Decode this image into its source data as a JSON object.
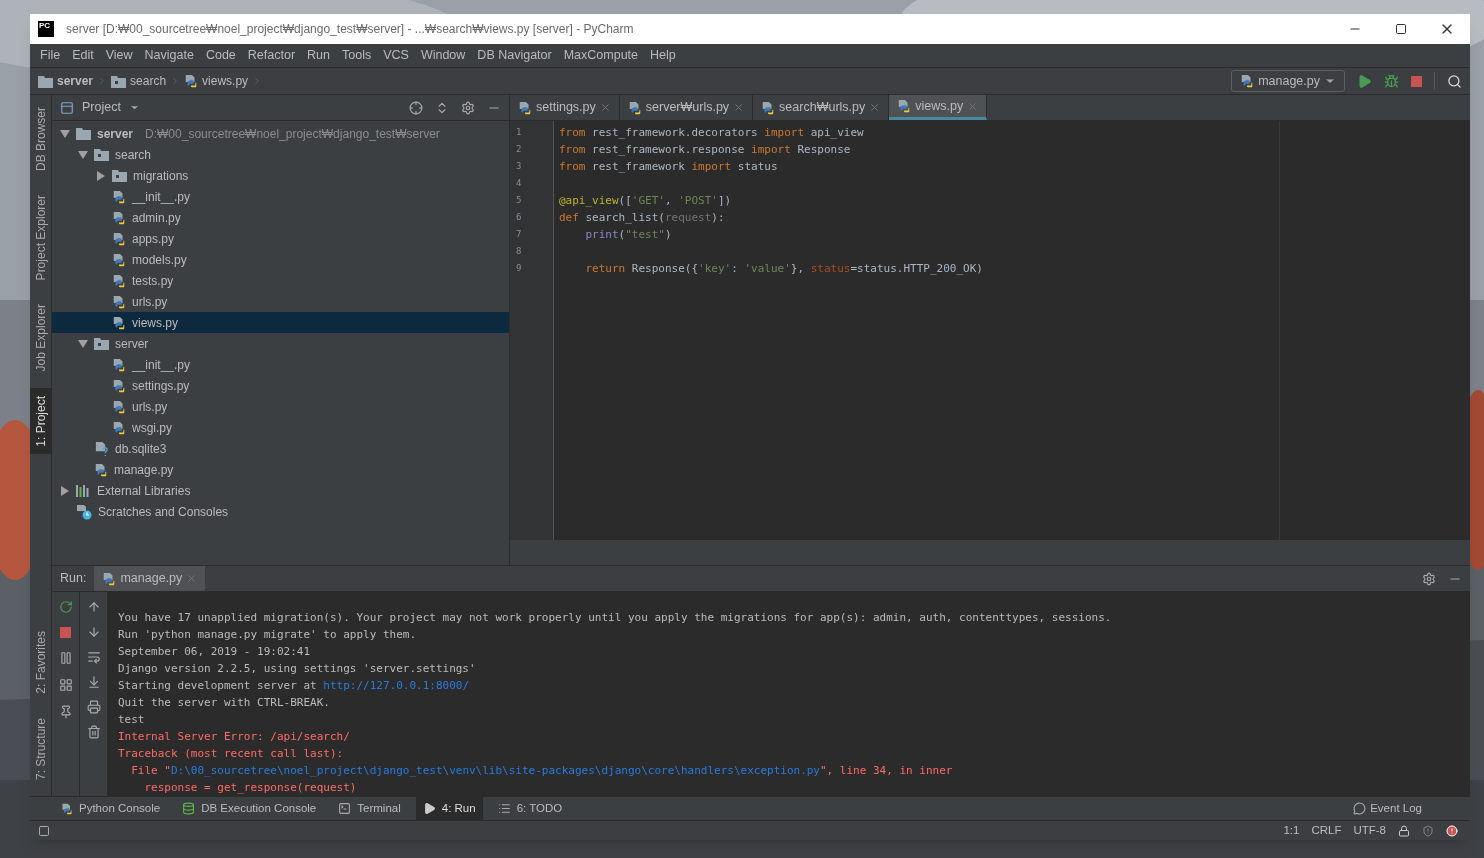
{
  "window": {
    "title": "server [D:₩00_sourcetree₩noel_project₩django_test₩server] - ...₩search₩views.py [server] - PyCharm",
    "app_icon": "PC"
  },
  "menu": [
    "File",
    "Edit",
    "View",
    "Navigate",
    "Code",
    "Refactor",
    "Run",
    "Tools",
    "VCS",
    "Window",
    "DB Navigator",
    "MaxCompute",
    "Help"
  ],
  "breadcrumb": [
    {
      "label": "server",
      "kind": "root"
    },
    {
      "label": "search",
      "kind": "folder"
    },
    {
      "label": "views.py",
      "kind": "file"
    }
  ],
  "run_config": "manage.py",
  "left_tools_top": [
    {
      "label": "DB Browser",
      "selected": false
    },
    {
      "label": "Project Explorer",
      "selected": false
    },
    {
      "label": "Job Explorer",
      "selected": false
    },
    {
      "label": "1: Project",
      "selected": true
    }
  ],
  "left_tools_bottom": [
    {
      "label": "2: Favorites",
      "selected": false
    },
    {
      "label": "7: Structure",
      "selected": false
    }
  ],
  "project_panel": {
    "title": "Project",
    "tree": [
      {
        "label": "server",
        "path": "D:₩00_sourcetree₩noel_project₩django_test₩server",
        "kind": "root",
        "expanded": true,
        "selected": false,
        "children": [
          {
            "label": "search",
            "kind": "folder",
            "expanded": true,
            "selected": false,
            "children": [
              {
                "label": "migrations",
                "kind": "folder",
                "expanded": false,
                "selected": false
              },
              {
                "label": "__init__.py",
                "kind": "py",
                "selected": false
              },
              {
                "label": "admin.py",
                "kind": "py",
                "selected": false
              },
              {
                "label": "apps.py",
                "kind": "py",
                "selected": false
              },
              {
                "label": "models.py",
                "kind": "py",
                "selected": false
              },
              {
                "label": "tests.py",
                "kind": "py",
                "selected": false
              },
              {
                "label": "urls.py",
                "kind": "py",
                "selected": false
              },
              {
                "label": "views.py",
                "kind": "py",
                "selected": true
              }
            ]
          },
          {
            "label": "server",
            "kind": "folder",
            "expanded": true,
            "selected": false,
            "children": [
              {
                "label": "__init__.py",
                "kind": "py",
                "selected": false
              },
              {
                "label": "settings.py",
                "kind": "py",
                "selected": false
              },
              {
                "label": "urls.py",
                "kind": "py",
                "selected": false
              },
              {
                "label": "wsgi.py",
                "kind": "py",
                "selected": false
              }
            ]
          },
          {
            "label": "db.sqlite3",
            "kind": "unknown",
            "selected": false
          },
          {
            "label": "manage.py",
            "kind": "py",
            "selected": false
          }
        ]
      },
      {
        "label": "External Libraries",
        "kind": "libs",
        "expanded": false,
        "selected": false
      },
      {
        "label": "Scratches and Consoles",
        "kind": "scratches",
        "selected": false
      }
    ]
  },
  "editor_tabs": [
    {
      "label": "settings.py",
      "selected": false
    },
    {
      "label": "server₩urls.py",
      "selected": false
    },
    {
      "label": "search₩urls.py",
      "selected": false
    },
    {
      "label": "views.py",
      "selected": true
    }
  ],
  "code": [
    {
      "number": "1",
      "tokens": [
        {
          "kind": "kw",
          "text": "from"
        },
        {
          "kind": "plain",
          "text": " rest_framework.decorators "
        },
        {
          "kind": "kw",
          "text": "import"
        },
        {
          "kind": "plain",
          "text": " api_view"
        }
      ]
    },
    {
      "number": "2",
      "tokens": [
        {
          "kind": "kw",
          "text": "from"
        },
        {
          "kind": "plain",
          "text": " rest_framework.response "
        },
        {
          "kind": "kw",
          "text": "import"
        },
        {
          "kind": "plain",
          "text": " Response"
        }
      ]
    },
    {
      "number": "3",
      "tokens": [
        {
          "kind": "kw",
          "text": "from"
        },
        {
          "kind": "plain",
          "text": " rest_framework "
        },
        {
          "kind": "kw",
          "text": "import"
        },
        {
          "kind": "plain",
          "text": " status"
        }
      ]
    },
    {
      "number": "4"
    },
    {
      "number": "5",
      "tokens": [
        {
          "kind": "deco",
          "text": "@api_view"
        },
        {
          "kind": "plain",
          "text": "(["
        },
        {
          "kind": "str",
          "text": "'GET'"
        },
        {
          "kind": "plain",
          "text": ", "
        },
        {
          "kind": "str",
          "text": "'POST'"
        },
        {
          "kind": "plain",
          "text": "])"
        }
      ]
    },
    {
      "number": "6",
      "tokens": [
        {
          "kind": "kw",
          "text": "def"
        },
        {
          "kind": "plain",
          "text": " search_list("
        },
        {
          "kind": "unused",
          "text": "request"
        },
        {
          "kind": "plain",
          "text": "):"
        }
      ]
    },
    {
      "number": "7",
      "tokens": [
        {
          "kind": "builtin",
          "text": "    print"
        },
        {
          "kind": "plain",
          "text": "("
        },
        {
          "kind": "str",
          "text": "\"test\""
        },
        {
          "kind": "plain",
          "text": ")"
        }
      ]
    },
    {
      "number": "8"
    },
    {
      "number": "9",
      "tokens": [
        {
          "kind": "kw",
          "text": "    return"
        },
        {
          "kind": "plain",
          "text": " Response({"
        },
        {
          "kind": "str",
          "text": "'key'"
        },
        {
          "kind": "plain",
          "text": ": "
        },
        {
          "kind": "str",
          "text": "'value'"
        },
        {
          "kind": "plain",
          "text": "}, "
        },
        {
          "kind": "param",
          "text": "status"
        },
        {
          "kind": "plain",
          "text": "=status.HTTP_200_OK)"
        }
      ]
    }
  ],
  "run_panel": {
    "label": "Run:",
    "tab": "manage.py",
    "console": [
      {
        "segments": [
          {
            "kind": "normal",
            "text": "You have 17 unapplied migration(s). Your project may not work properly until you apply the migrations for app(s): admin, auth, contenttypes, sessions."
          }
        ]
      },
      {
        "segments": [
          {
            "kind": "normal",
            "text": "Run 'python manage.py migrate' to apply them."
          }
        ]
      },
      {
        "segments": [
          {
            "kind": "normal",
            "text": "September 06, 2019 - 19:02:41"
          }
        ]
      },
      {
        "segments": [
          {
            "kind": "normal",
            "text": "Django version 2.2.5, using settings 'server.settings'"
          }
        ]
      },
      {
        "segments": [
          {
            "kind": "normal",
            "text": "Starting development server at "
          },
          {
            "kind": "link",
            "text": "http://127.0.0.1:8000/"
          }
        ]
      },
      {
        "segments": [
          {
            "kind": "normal",
            "text": "Quit the server with CTRL-BREAK."
          }
        ]
      },
      {
        "segments": [
          {
            "kind": "normal",
            "text": "test"
          }
        ]
      },
      {
        "segments": [
          {
            "kind": "error",
            "text": "Internal Server Error: /api/search/"
          }
        ]
      },
      {
        "segments": [
          {
            "kind": "error",
            "text": "Traceback (most recent call last):"
          }
        ]
      },
      {
        "segments": [
          {
            "kind": "error",
            "text": "  File \""
          },
          {
            "kind": "link",
            "text": "D:\\00_sourcetree\\noel_project\\django_test\\venv\\lib\\site-packages\\django\\core\\handlers\\exception.py"
          },
          {
            "kind": "error",
            "text": "\", line 34, in inner"
          }
        ]
      },
      {
        "segments": [
          {
            "kind": "error",
            "text": "    response = get_response(request)"
          }
        ]
      }
    ]
  },
  "bottom_tabs": [
    {
      "label": "Python Console",
      "kind": "python",
      "selected": false
    },
    {
      "label": "DB Execution Console",
      "kind": "db",
      "selected": false
    },
    {
      "label": "Terminal",
      "kind": "terminal",
      "selected": false
    },
    {
      "label": "4: Run",
      "kind": "run",
      "selected": true
    },
    {
      "label": "6: TODO",
      "kind": "todo",
      "selected": false
    }
  ],
  "event_log": "Event Log",
  "status_bar": {
    "position": "1:1",
    "line_separator": "CRLF",
    "encoding": "UTF-8"
  }
}
